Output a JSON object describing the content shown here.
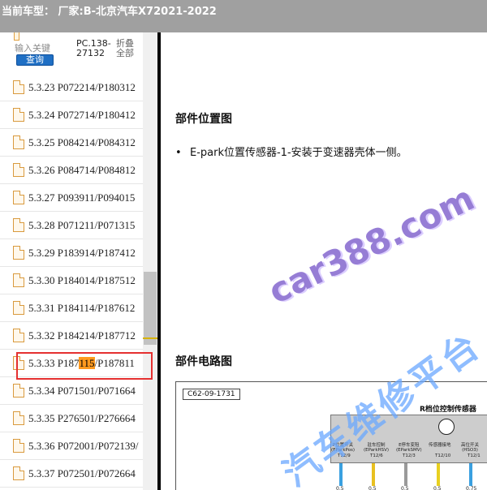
{
  "titlebar": {
    "text": "当前车型： 厂家:B-北京汽车X72021-2022"
  },
  "sidebar": {
    "search": {
      "placeholder": "输入关键",
      "button_label": "查询",
      "pc_code": "PC.138-27132",
      "collapse_label": "折叠全部"
    },
    "items": [
      {
        "label": "5.3.23 P072214/P180312"
      },
      {
        "label": "5.3.24 P072714/P180412"
      },
      {
        "label": "5.3.25 P084214/P084312"
      },
      {
        "label": "5.3.26 P084714/P084812"
      },
      {
        "label": "5.3.27 P093911/P094015"
      },
      {
        "label": "5.3.28 P071211/P071315"
      },
      {
        "label": "5.3.29 P183914/P187412"
      },
      {
        "label": "5.3.30 P184014/P187512"
      },
      {
        "label": "5.3.31 P184114/P187612"
      },
      {
        "label": "5.3.32 P184214/P187712"
      },
      {
        "pre": "5.3.33 P187",
        "highlight": "115",
        "post": "/P187811"
      },
      {
        "label": "5.3.34 P071501/P071664"
      },
      {
        "label": "5.3.35 P276501/P276664"
      },
      {
        "label": "5.3.36 P072001/P072139/"
      },
      {
        "label": "5.3.37 P072501/P072664"
      }
    ],
    "selected_index": 10,
    "highlight_color": "#ff9a1f",
    "selection_border_color": "#e53030"
  },
  "content": {
    "section1_title": "部件位置图",
    "bullet_symbol": "•",
    "bullet_text": "E-park位置传感器-1-安装于变速器壳体一侧。",
    "section2_title": "部件电路图",
    "watermark_1": "car388.com",
    "watermark_2": "汽车维修平台",
    "diagram": {
      "id_label": "C62-09-1731",
      "module_title": "R档位控制传感器",
      "pins": [
        {
          "label": "P位置开关\n(EParkPos)",
          "pin": "T12/9",
          "wire": "0.5",
          "color": "#3aa0e0"
        },
        {
          "label": "驻车控制\n(EParkHSV)",
          "pin": "T12/6",
          "wire": "0.5",
          "color": "#e8c020"
        },
        {
          "label": "E停车变阻\n(EParkSMV)",
          "pin": "T12/3",
          "wire": "0.5",
          "color": "#9a9a9a"
        },
        {
          "label": "传感器接地",
          "pin": "T12/10",
          "wire": "0.5",
          "color": "#e8d020"
        },
        {
          "label": "高位开关\n(HSO3)",
          "pin": "T12/1",
          "wire": "0.75",
          "color": "#3aa0e0"
        }
      ]
    }
  }
}
